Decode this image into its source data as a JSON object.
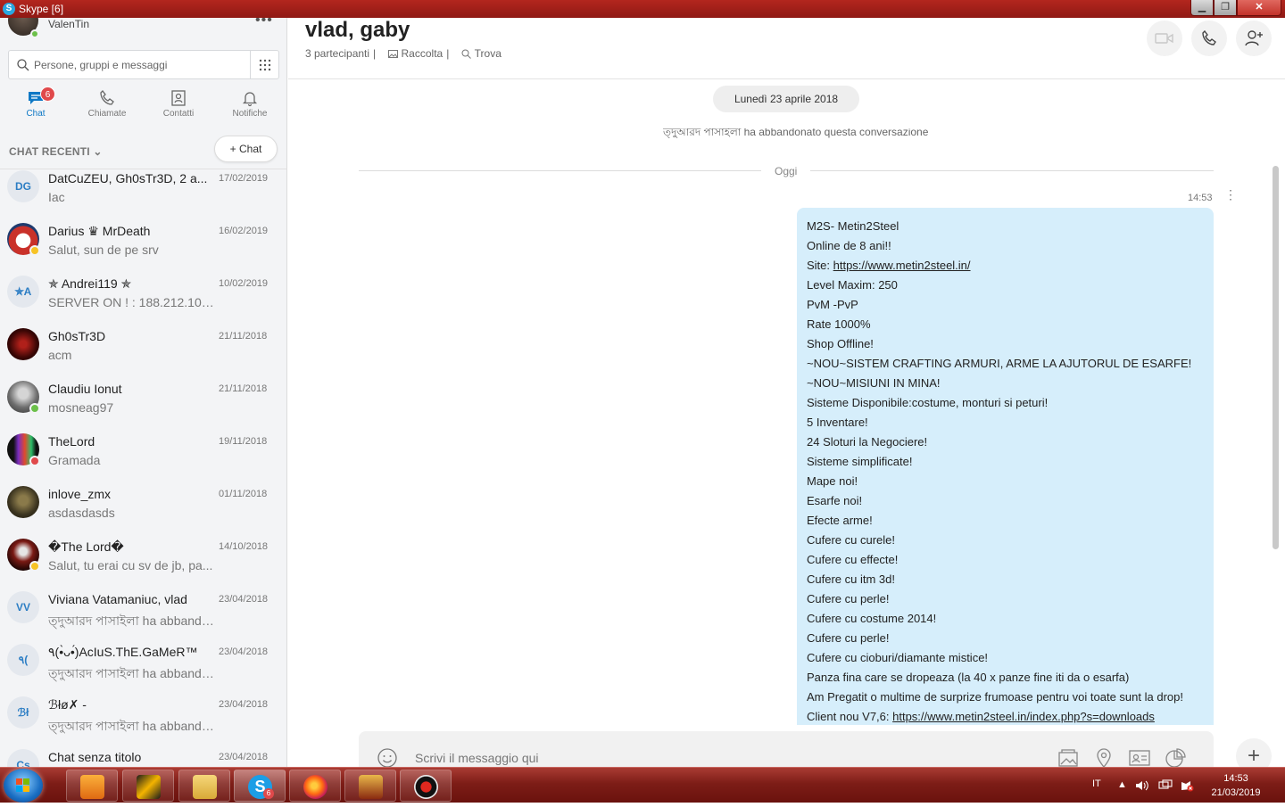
{
  "window": {
    "title": "Skype [6]",
    "app_icon": "S"
  },
  "sidebar": {
    "user_name": "ValenTin",
    "more": "•••",
    "search_placeholder": "Persone, gruppi e messaggi",
    "tabs": [
      {
        "label": "Chat",
        "badge": "6"
      },
      {
        "label": "Chiamate"
      },
      {
        "label": "Contatti"
      },
      {
        "label": "Notifiche"
      }
    ],
    "recent_label": "CHAT RECENTI",
    "new_chat": "+ Chat",
    "chats": [
      {
        "name": "DatCuZEU, Gh0sTr3D, 2 a...",
        "date": "17/02/2019",
        "preview": "Iac",
        "initials": "DG"
      },
      {
        "name": "Darius ♛ MrDeath",
        "date": "16/02/2019",
        "preview": "Salut, sun de pe srv",
        "initials": ""
      },
      {
        "name": "✯ Andrei119 ✯",
        "date": "10/02/2019",
        "preview": "SERVER ON ! : 188.212.100....",
        "initials": "✯A"
      },
      {
        "name": "Gh0sTr3D",
        "date": "21/11/2018",
        "preview": "acm",
        "initials": ""
      },
      {
        "name": "Claudiu Ionut",
        "date": "21/11/2018",
        "preview": "mosneag97",
        "initials": ""
      },
      {
        "name": "TheLord",
        "date": "19/11/2018",
        "preview": "Gramada",
        "initials": ""
      },
      {
        "name": "inlove_zmx",
        "date": "01/11/2018",
        "preview": "asdasdasds",
        "initials": ""
      },
      {
        "name": "�The Lord�",
        "date": "14/10/2018",
        "preview": "Salut, tu erai cu sv de jb, pa...",
        "initials": ""
      },
      {
        "name": "Viviana Vatamaniuc, vlad",
        "date": "23/04/2018",
        "preview": "ত্দুআরদ পাসাইলা ha abbando...",
        "initials": "VV"
      },
      {
        "name": "٩(•̀ᴗ•́)AcIuS.ThE.GaMeR™",
        "date": "23/04/2018",
        "preview": "ত্দুআরদ পাসাইলা ha abbando...",
        "initials": "٩("
      },
      {
        "name": "ℬłø✗ -",
        "date": "23/04/2018",
        "preview": "ত্দুআরদ পাসাইলা ha abbando...",
        "initials": "ℬł"
      },
      {
        "name": "Chat senza titolo",
        "date": "23/04/2018",
        "preview": "",
        "initials": "Cs"
      }
    ]
  },
  "conversation": {
    "title": "vlad, gaby",
    "participants": "3 partecipanti",
    "sep": "|",
    "gallery": "Raccolta",
    "find": "Trova",
    "date_pill": "Lunedì 23 aprile 2018",
    "system_message": "ত্দুআরদ পাসাইলা ha abbandonato questa conversazione",
    "today_label": "Oggi",
    "message_time": "14:53",
    "message_more": "⋮",
    "message_lines": [
      "M2S- Metin2Steel",
      "Online de 8 ani!!",
      "Level Maxim: 250",
      "PvM -PvP",
      "Rate 1000%",
      "Shop Offline!",
      "~NOU~SISTEM CRAFTING ARMURI, ARME LA AJUTORUL DE ESARFE!",
      "~NOU~MISIUNI IN MINA!",
      "Sisteme Disponibile:costume, monturi si peturi!",
      "5 Inventare!",
      "24 Sloturi la Negociere!",
      "Sisteme simplificate!",
      "Mape noi!",
      "Esarfe noi!",
      "Efecte arme!",
      "Cufere cu curele!",
      "Cufere cu effecte!",
      "Cufere cu itm 3d!",
      "Cufere cu perle!",
      "Cufere cu costume 2014!",
      "Cufere cu perle!",
      "Cufere cu cioburi/diamante mistice!",
      "Panza fina care se dropeaza (la 40 x panze fine iti da o esarfa)",
      "Am Pregatit o multime de surprize frumoase pentru voi toate sunt la drop!"
    ],
    "site_prefix": "Site: ",
    "site_link": "https://www.metin2steel.in/",
    "client_prefix": "Client nou V7,6: ",
    "client_link": "https://www.metin2steel.in/index.php?s=downloads",
    "compose_placeholder": "Scrivi il messaggio qui",
    "plus": "+"
  },
  "taskbar": {
    "language": "IT",
    "time": "14:53",
    "date": "21/03/2019",
    "skype_badge": "6"
  },
  "colors": {
    "accent": "#0e78c5",
    "bubble": "#d6eefb",
    "titlebar": "#b3261e",
    "badge": "#e0494b"
  }
}
